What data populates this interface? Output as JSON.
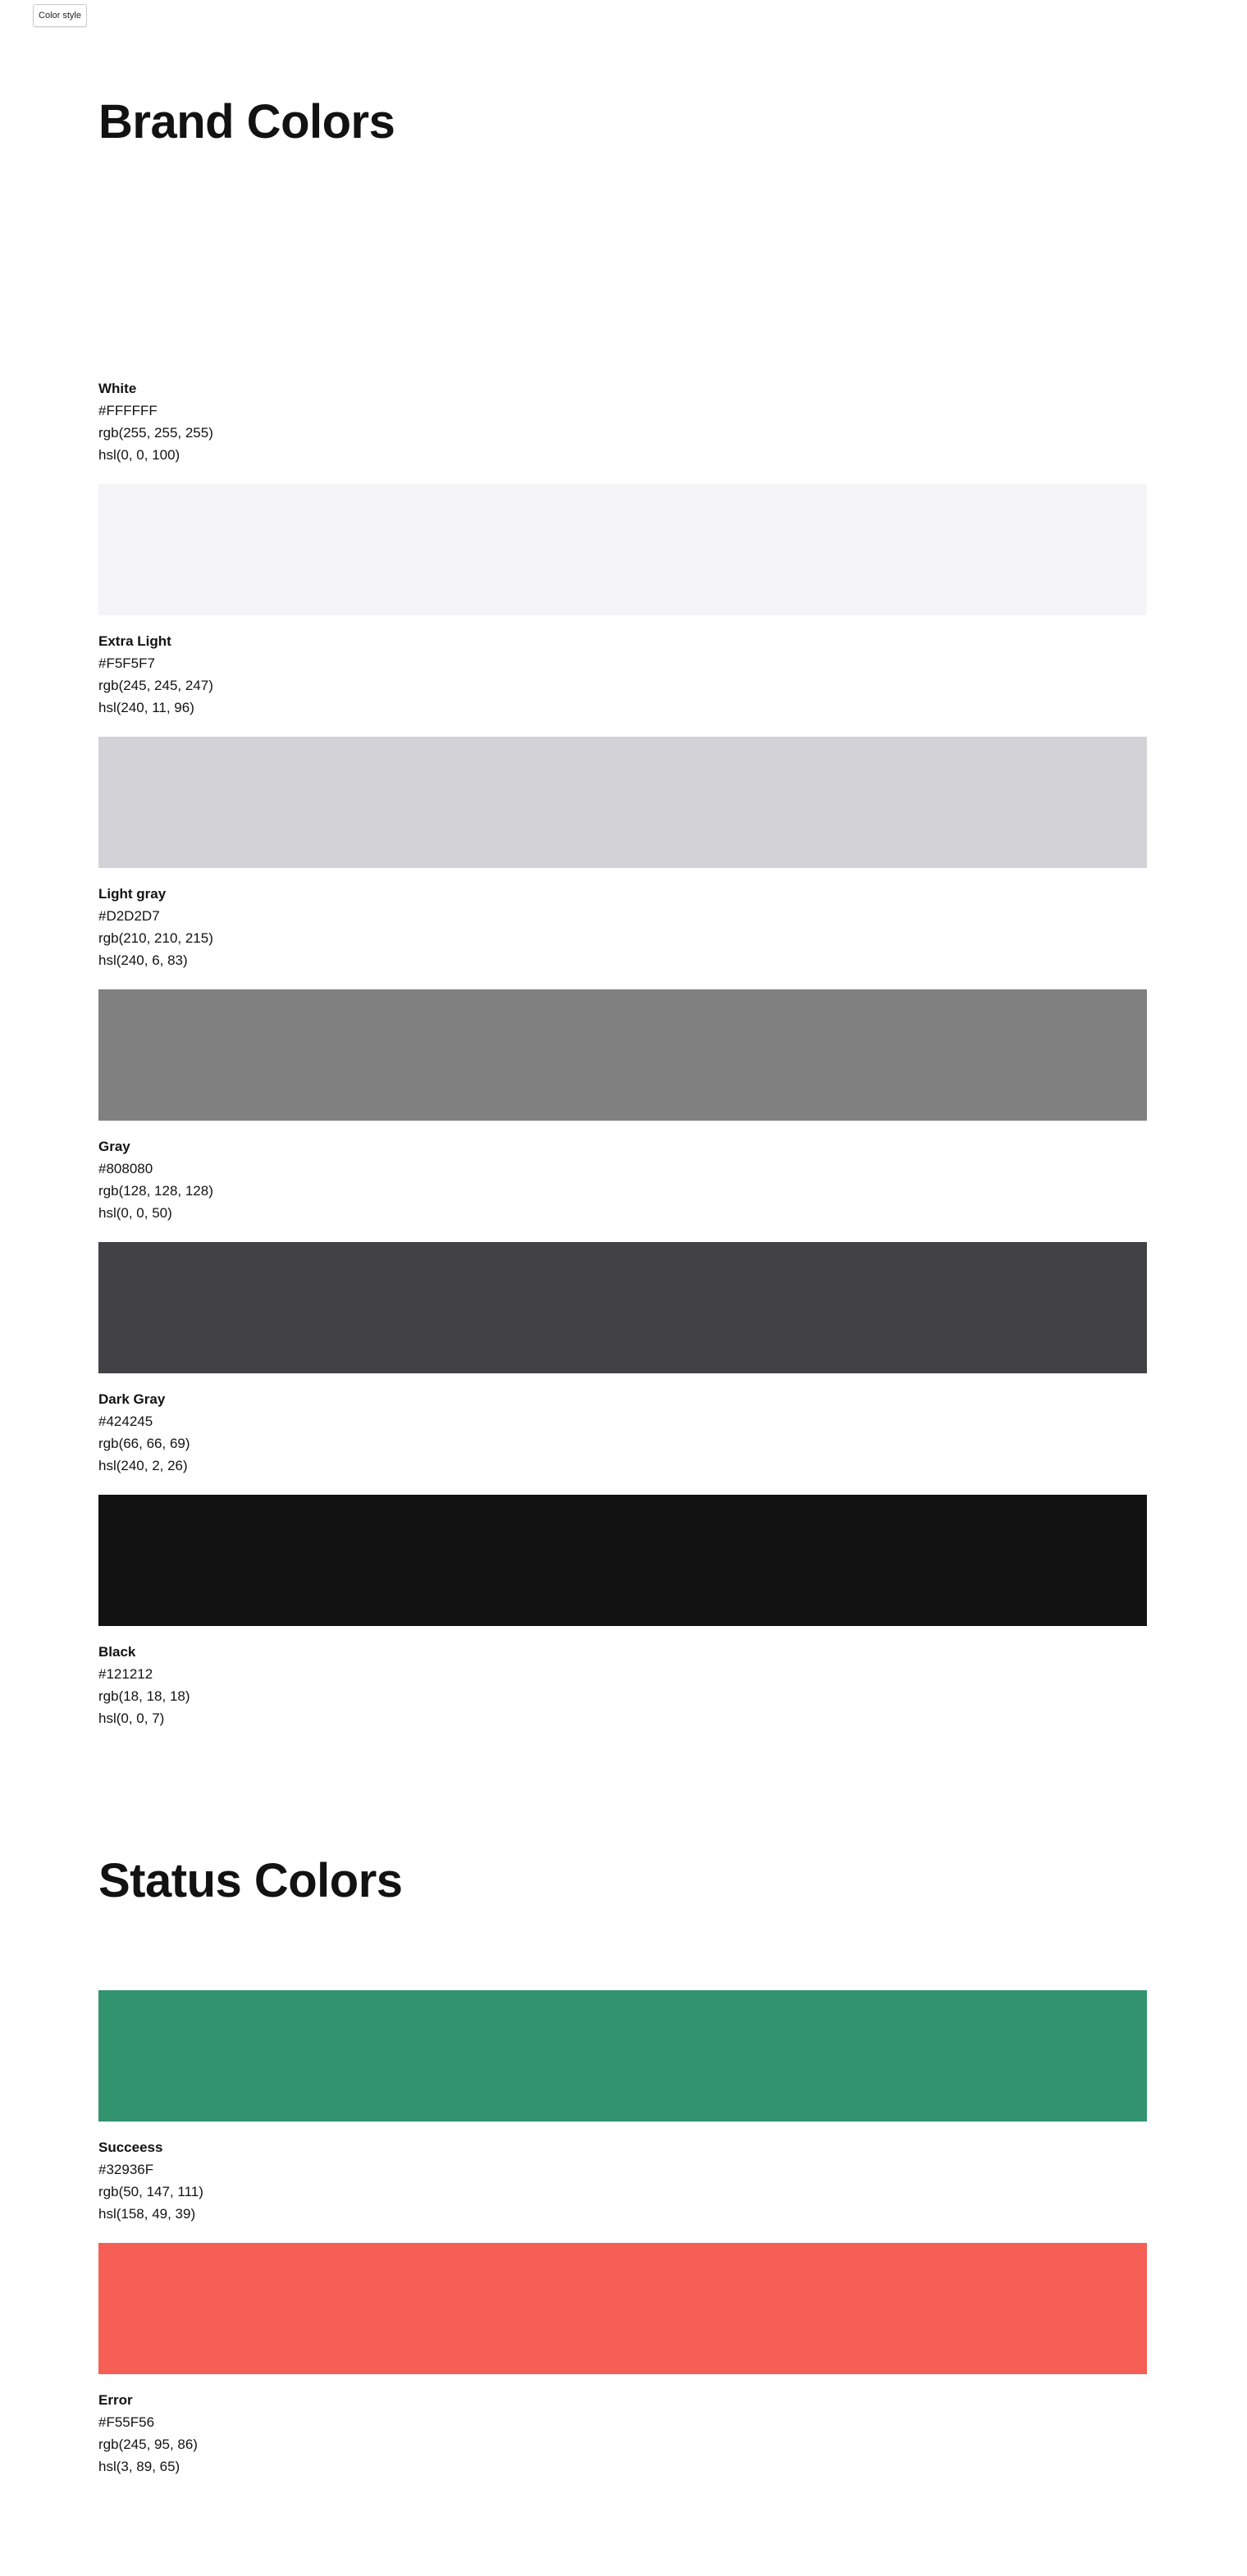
{
  "toolbar": {
    "color_style_label": "Color style"
  },
  "brand": {
    "title": "Brand Colors",
    "colors": [
      {
        "name": "White",
        "hex": "#FFFFFF",
        "rgb": "rgb(255, 255, 255)",
        "hsl": "hsl(0, 0, 100)",
        "swatch": "#FFFFFF"
      },
      {
        "name": "Extra Light",
        "hex": "#F5F5F7",
        "rgb": "rgb(245, 245, 247)",
        "hsl": "hsl(240, 11, 96)",
        "swatch": "#F5F5F7"
      },
      {
        "name": "Light gray",
        "hex": "#D2D2D7",
        "rgb": "rgb(210, 210, 215)",
        "hsl": "hsl(240, 6, 83)",
        "swatch": "#D2D2D7"
      },
      {
        "name": "Gray",
        "hex": "#808080",
        "rgb": "rgb(128, 128, 128)",
        "hsl": "hsl(0, 0, 50)",
        "swatch": "#808080"
      },
      {
        "name": "Dark Gray",
        "hex": "#424245",
        "rgb": "rgb(66, 66, 69)",
        "hsl": "hsl(240, 2, 26)",
        "swatch": "#424245"
      },
      {
        "name": "Black",
        "hex": "#121212",
        "rgb": "rgb(18, 18, 18)",
        "hsl": "hsl(0, 0, 7)",
        "swatch": "#121212"
      }
    ]
  },
  "status": {
    "title": "Status Colors",
    "colors": [
      {
        "name": "Succeess",
        "hex": "#32936F",
        "rgb": "rgb(50, 147, 111)",
        "hsl": "hsl(158, 49, 39)",
        "swatch": "#32936F"
      },
      {
        "name": "Error",
        "hex": "#F55F56",
        "rgb": "rgb(245, 95, 86)",
        "hsl": "hsl(3, 89, 65)",
        "swatch": "#F55F56"
      }
    ]
  }
}
